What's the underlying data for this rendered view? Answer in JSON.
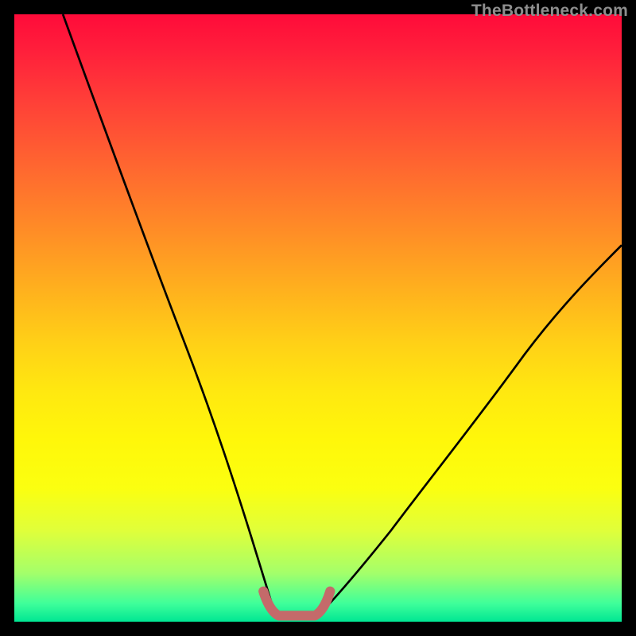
{
  "watermark": "TheBottleneck.com",
  "chart_data": {
    "type": "line",
    "title": "",
    "xlabel": "",
    "ylabel": "",
    "xlim": [
      0,
      100
    ],
    "ylim": [
      0,
      100
    ],
    "grid": false,
    "series": [
      {
        "name": "curve-left",
        "x": [
          8,
          12,
          16,
          20,
          24,
          28,
          32,
          35,
          38,
          40,
          41.5,
          43
        ],
        "y": [
          100,
          84,
          69,
          55,
          42,
          30,
          20,
          12,
          6,
          2.5,
          1,
          0
        ]
      },
      {
        "name": "curve-right",
        "x": [
          50,
          52,
          55,
          60,
          66,
          72,
          78,
          85,
          92,
          100
        ],
        "y": [
          0,
          1,
          3,
          8,
          16,
          25,
          34,
          44,
          53,
          62
        ]
      },
      {
        "name": "bracket",
        "x": [
          41,
          42,
          43,
          44,
          45,
          46,
          47,
          48,
          49,
          50,
          51,
          52
        ],
        "y": [
          4.5,
          2.5,
          1.2,
          0.6,
          0.4,
          0.4,
          0.4,
          0.4,
          0.6,
          1.2,
          2.5,
          4.5
        ]
      }
    ],
    "annotations": [],
    "background_gradient": {
      "top": "#ff0b3a",
      "mid": "#ffe810",
      "bottom": "#00e693"
    },
    "bracket_color": "#c46a6a",
    "curve_color": "#000000"
  }
}
